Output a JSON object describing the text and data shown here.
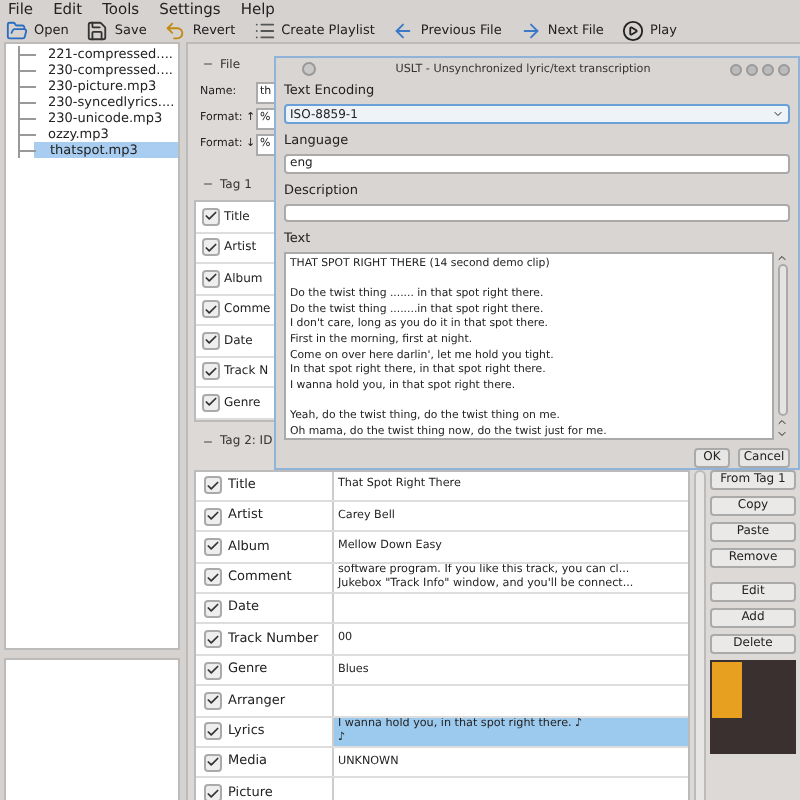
{
  "menu": [
    "File",
    "Edit",
    "Tools",
    "Settings",
    "Help"
  ],
  "toolbar": [
    {
      "label": "Open",
      "kind": "open"
    },
    {
      "label": "Save",
      "kind": "save"
    },
    {
      "label": "Revert",
      "kind": "revert"
    },
    {
      "label": "Create Playlist",
      "kind": "playlist"
    },
    {
      "label": "Previous File",
      "kind": "prev"
    },
    {
      "label": "Next File",
      "kind": "next"
    },
    {
      "label": "Play",
      "kind": "play"
    }
  ],
  "files": [
    {
      "name": "221-compressed....",
      "selected": false
    },
    {
      "name": "230-compressed....",
      "selected": false
    },
    {
      "name": "230-picture.mp3",
      "selected": false
    },
    {
      "name": "230-syncedlyrics....",
      "selected": false
    },
    {
      "name": "230-unicode.mp3",
      "selected": false
    },
    {
      "name": "ozzy.mp3",
      "selected": false
    },
    {
      "name": "thatspot.mp3",
      "selected": true
    }
  ],
  "file_section": {
    "title": "File",
    "fields": [
      {
        "label": "Name:",
        "value": "th"
      },
      {
        "label": "Format: ↑",
        "value": "%"
      },
      {
        "label": "Format: ↓",
        "value": "%"
      }
    ]
  },
  "tag1": {
    "title": "Tag 1",
    "rows": [
      {
        "label": "Title",
        "checked": true
      },
      {
        "label": "Artist",
        "checked": true
      },
      {
        "label": "Album",
        "checked": true
      },
      {
        "label": "Comme",
        "checked": true
      },
      {
        "label": "Date",
        "checked": true
      },
      {
        "label": "Track N",
        "checked": true
      },
      {
        "label": "Genre",
        "checked": true
      }
    ]
  },
  "tag2": {
    "title": "Tag 2: ID",
    "rows": [
      {
        "label": "Title",
        "checked": true,
        "value": [
          "That Spot Right There"
        ],
        "selected": false
      },
      {
        "label": "Artist",
        "checked": true,
        "value": [
          "Carey Bell"
        ],
        "selected": false
      },
      {
        "label": "Album",
        "checked": true,
        "value": [
          "Mellow Down Easy"
        ],
        "selected": false
      },
      {
        "label": "Comment",
        "checked": true,
        "value": [
          "software program.  If you like this track, you can cl...",
          "Jukebox \"Track Info\" window, and you'll be connect..."
        ],
        "selected": false
      },
      {
        "label": "Date",
        "checked": true,
        "value": [],
        "selected": false
      },
      {
        "label": "Track Number",
        "checked": true,
        "value": [
          "00"
        ],
        "selected": false
      },
      {
        "label": "Genre",
        "checked": true,
        "value": [
          "Blues"
        ],
        "selected": false
      },
      {
        "label": "Arranger",
        "checked": true,
        "value": [],
        "selected": false
      },
      {
        "label": "Lyrics",
        "checked": true,
        "value": [
          "I wanna hold you, in that spot right there. ♪",
          "♪"
        ],
        "selected": true
      },
      {
        "label": "Media",
        "checked": true,
        "value": [
          "UNKNOWN"
        ],
        "selected": false
      },
      {
        "label": "Picture",
        "checked": true,
        "value": [],
        "selected": false
      }
    ],
    "buttons": [
      "From Tag 1",
      "Copy",
      "Paste",
      "Remove",
      "Edit",
      "Add",
      "Delete"
    ]
  },
  "dialog": {
    "title": "USLT - Unsynchronized lyric/text transcription",
    "encoding_label": "Text Encoding",
    "encoding": "ISO-8859-1",
    "language_label": "Language",
    "language": "eng",
    "description_label": "Description",
    "text_label": "Text",
    "paragraphs": [
      [
        "THAT SPOT RIGHT THERE  (14 second demo clip)"
      ],
      [
        "Do the twist thing ....... in that spot right there.",
        "Do the twist thing ........in that spot right there.",
        "I don't care, long as you do it in that spot there.",
        "First in the morning, first at night.",
        "Come on over here darlin', let me hold you tight.",
        "In that spot right there, in that spot right there.",
        "I wanna hold you, in that spot right there."
      ],
      [
        "Yeah, do the twist thing, do the twist thing on me.",
        "Oh mama, do the twist thing now, do the twist just for me."
      ]
    ],
    "buttons": [
      "OK",
      "Cancel"
    ]
  }
}
